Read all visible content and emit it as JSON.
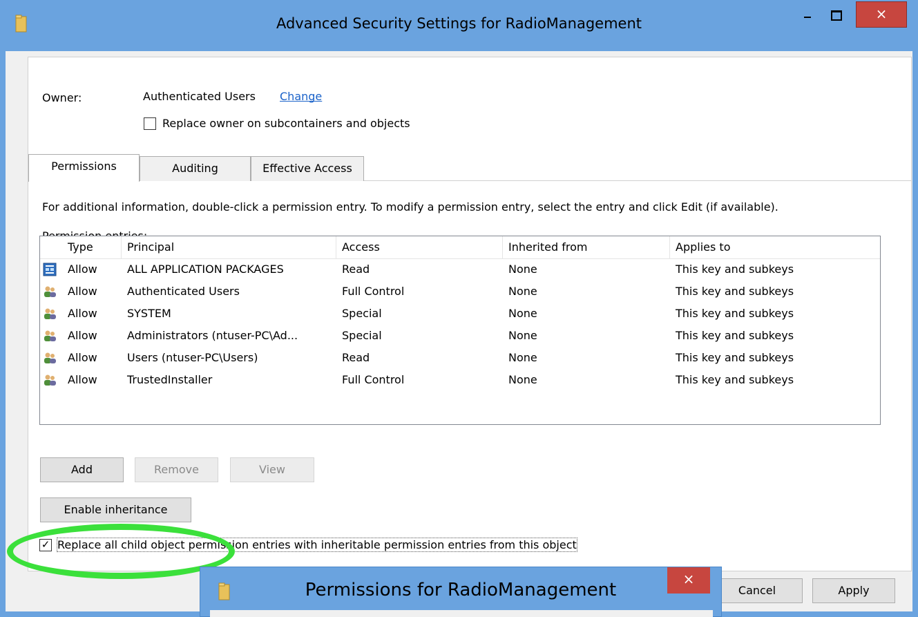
{
  "window": {
    "title": "Advanced Security Settings for RadioManagement",
    "close_glyph": "×"
  },
  "owner": {
    "label": "Owner:",
    "value": "Authenticated Users",
    "change_link": "Change",
    "replace_checkbox_label": "Replace owner on subcontainers and objects",
    "replace_checked": false
  },
  "tabs": [
    {
      "label": "Permissions",
      "active": true
    },
    {
      "label": "Auditing",
      "active": false
    },
    {
      "label": "Effective Access",
      "active": false
    }
  ],
  "info_text": "For additional information, double-click a permission entry. To modify a permission entry, select the entry and click Edit (if available).",
  "entries_label": "Permission entries:",
  "table": {
    "headers": [
      "Type",
      "Principal",
      "Access",
      "Inherited from",
      "Applies to"
    ],
    "rows": [
      {
        "icon": "packages-icon",
        "type": "Allow",
        "principal": "ALL APPLICATION PACKAGES",
        "access": "Read",
        "inherited": "None",
        "applies": "This key and subkeys"
      },
      {
        "icon": "users-icon",
        "type": "Allow",
        "principal": "Authenticated Users",
        "access": "Full Control",
        "inherited": "None",
        "applies": "This key and subkeys"
      },
      {
        "icon": "users-icon",
        "type": "Allow",
        "principal": "SYSTEM",
        "access": "Special",
        "inherited": "None",
        "applies": "This key and subkeys"
      },
      {
        "icon": "users-icon",
        "type": "Allow",
        "principal": "Administrators (ntuser-PC\\Ad...",
        "access": "Special",
        "inherited": "None",
        "applies": "This key and subkeys"
      },
      {
        "icon": "users-icon",
        "type": "Allow",
        "principal": "Users (ntuser-PC\\Users)",
        "access": "Read",
        "inherited": "None",
        "applies": "This key and subkeys"
      },
      {
        "icon": "users-icon",
        "type": "Allow",
        "principal": "TrustedInstaller",
        "access": "Full Control",
        "inherited": "None",
        "applies": "This key and subkeys"
      }
    ]
  },
  "buttons": {
    "add": "Add",
    "remove": "Remove",
    "view": "View",
    "enable_inheritance": "Enable inheritance",
    "cancel": "Cancel",
    "apply": "Apply"
  },
  "replace_child": {
    "label": "Replace all child object permission entries with inheritable permission entries from this object",
    "checked": true
  },
  "dialog2": {
    "title": "Permissions for RadioManagement",
    "close_glyph": "×"
  },
  "colors": {
    "titlebar": "#6aa3df",
    "close_button": "#c7463f",
    "highlight_ellipse": "#3be03b",
    "link": "#1a62c9"
  }
}
